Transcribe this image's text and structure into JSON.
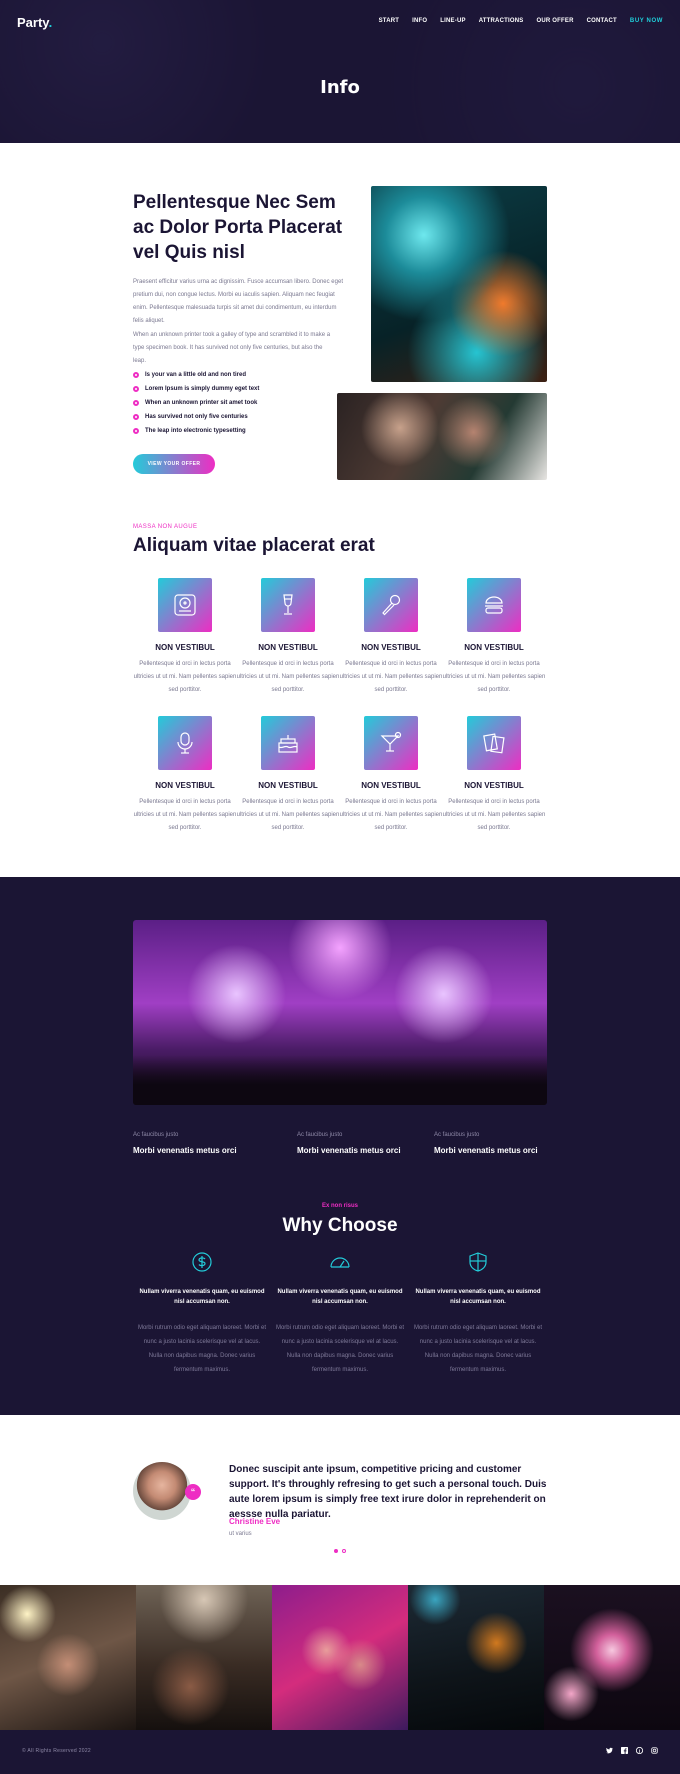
{
  "header": {
    "logo": "Party",
    "logo_dot": ".",
    "nav": [
      "START",
      "INFO",
      "LINE-UP",
      "ATTRACTIONS",
      "OUR OFFER",
      "CONTACT"
    ],
    "buy_label": "BUY NOW",
    "page_title": "Info"
  },
  "intro": {
    "title": "Pellentesque Nec Sem ac Dolor Porta Placerat vel Quis nisl",
    "p1": "Praesent efficitur varius urna ac dignissim. Fusce accumsan libero. Donec eget pretium dui, non congue lectus. Morbi eu iaculis sapien. Aliquam nec feugiat enim. Pellentesque malesuada turpis sit amet dui condimentum, eu interdum felis aliquet.",
    "p2": "When an unknown printer took a galley of type and scrambled it to make a type specimen book. It has survived not only five centuries, but also the leap.",
    "bullets": [
      "Is your van a little old and non tired",
      "Lorem Ipsum is simply dummy eget text",
      "When an unknown printer sit amet took",
      "Has survived not only five centuries",
      "The leap into electronic typesetting"
    ],
    "button": "VIEW YOUR OFFER"
  },
  "features": {
    "kicker": "MASSA NON AUGUE",
    "title": "Aliquam vitae placerat erat",
    "items": [
      {
        "icon": "disc-player-icon",
        "title": "NON VESTIBUL",
        "text": "Pellentesque id orci in lectus porta ultricies ut ut mi. Nam pellentes sapien sed porttitor."
      },
      {
        "icon": "wine-glass-icon",
        "title": "NON VESTIBUL",
        "text": "Pellentesque id orci in lectus porta ultricies ut ut mi. Nam pellentes sapien sed porttitor."
      },
      {
        "icon": "microphone-icon",
        "title": "NON VESTIBUL",
        "text": "Pellentesque id orci in lectus porta ultricies ut ut mi. Nam pellentes sapien sed porttitor."
      },
      {
        "icon": "burger-icon",
        "title": "NON VESTIBUL",
        "text": "Pellentesque id orci in lectus porta ultricies ut ut mi. Nam pellentes sapien sed porttitor."
      },
      {
        "icon": "studio-mic-icon",
        "title": "NON VESTIBUL",
        "text": "Pellentesque id orci in lectus porta ultricies ut ut mi. Nam pellentes sapien sed porttitor."
      },
      {
        "icon": "cake-icon",
        "title": "NON VESTIBUL",
        "text": "Pellentesque id orci in lectus porta ultricies ut ut mi. Nam pellentes sapien sed porttitor."
      },
      {
        "icon": "cocktail-icon",
        "title": "NON VESTIBUL",
        "text": "Pellentesque id orci in lectus porta ultricies ut ut mi. Nam pellentes sapien sed porttitor."
      },
      {
        "icon": "cards-icon",
        "title": "NON VESTIBUL",
        "text": "Pellentesque id orci in lectus porta ultricies ut ut mi. Nam pellentes sapien sed porttitor."
      }
    ]
  },
  "stats": [
    {
      "kicker": "Ac faucibus justo",
      "title": "Morbi venenatis metus orci"
    },
    {
      "kicker": "Ac faucibus justo",
      "title": "Morbi venenatis metus orci"
    },
    {
      "kicker": "Ac faucibus justo",
      "title": "Morbi venenatis metus orci"
    }
  ],
  "why": {
    "kicker": "Ex non risus",
    "title": "Why Choose",
    "items": [
      {
        "icon": "dollar-icon",
        "heading": "Nullam viverra venenatis quam, eu euismod nisl accumsan non.",
        "text": "Morbi rutrum odio eget aliquam laoreet. Morbi et nunc a justo lacinia scelerisque vel at lacus. Nulla non dapibus magna. Donec varius fermentum maximus."
      },
      {
        "icon": "gauge-icon",
        "heading": "Nullam viverra venenatis quam, eu euismod nisl accumsan non.",
        "text": "Morbi rutrum odio eget aliquam laoreet. Morbi et nunc a justo lacinia scelerisque vel at lacus. Nulla non dapibus magna. Donec varius fermentum maximus."
      },
      {
        "icon": "shield-icon",
        "heading": "Nullam viverra venenatis quam, eu euismod nisl accumsan non.",
        "text": "Morbi rutrum odio eget aliquam laoreet. Morbi et nunc a justo lacinia scelerisque vel at lacus. Nulla non dapibus magna. Donec varius fermentum maximus."
      }
    ]
  },
  "testimonial": {
    "quote_mark": "“",
    "quote": "Donec suscipit ante ipsum, competitive pricing and customer support. It's throughly refresing to get such a personal touch. Duis aute lorem ipsum is simply free text irure dolor in reprehenderit on aessse nulla pariatur.",
    "name": "Christine Eve",
    "role": "ut varius"
  },
  "footer": {
    "copyright": "© All Rights Reserved 2022",
    "social": [
      "twitter-icon",
      "facebook-icon",
      "pinterest-icon",
      "instagram-icon"
    ]
  },
  "colors": {
    "navy": "#1b1534",
    "pink": "#ee2dc3",
    "cyan": "#23cbd9"
  }
}
